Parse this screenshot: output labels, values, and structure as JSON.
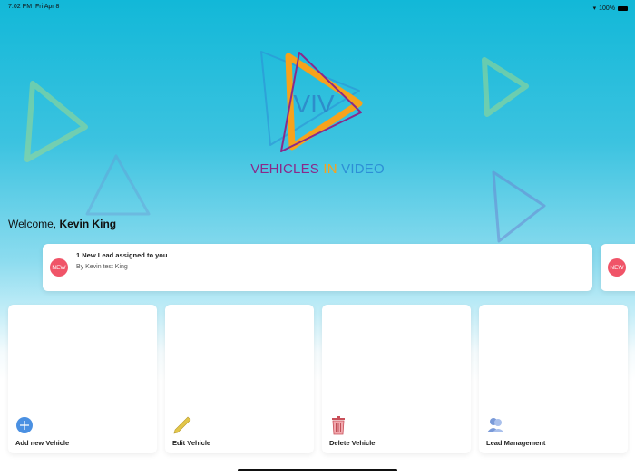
{
  "status_bar": {
    "time": "7:02 PM",
    "date": "Fri Apr 8",
    "battery": "100%"
  },
  "logo": {
    "monogram": "VIV",
    "brand_parts": [
      "VEHICLES ",
      "IN",
      " VIDEO"
    ]
  },
  "welcome": {
    "prefix": "Welcome, ",
    "name": "Kevin King"
  },
  "leads": [
    {
      "badge": "NEW",
      "title": "1 New Lead assigned to you",
      "subtitle": "By Kevin test King"
    },
    {
      "badge": "NEW"
    }
  ],
  "actions": [
    {
      "label": "Add new Vehicle",
      "icon": "plus-circle-icon"
    },
    {
      "label": "Edit Vehicle",
      "icon": "pencil-icon"
    },
    {
      "label": "Delete Vehicle",
      "icon": "trash-icon"
    },
    {
      "label": "Lead Management",
      "icon": "users-icon"
    }
  ],
  "colors": {
    "brand_purple": "#8a2a8a",
    "brand_orange": "#f7a21c",
    "brand_blue": "#2d8fd6",
    "badge": "#f05468"
  }
}
